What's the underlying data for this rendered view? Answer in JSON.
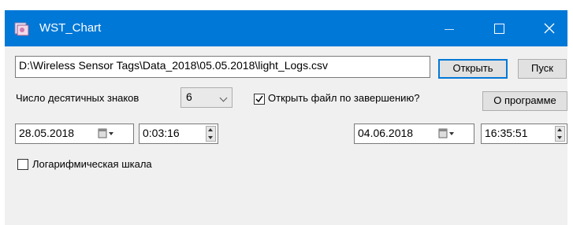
{
  "window": {
    "title": "WST_Chart",
    "accent": "#0078d7"
  },
  "file": {
    "path": "D:\\Wireless Sensor Tags\\Data_2018\\05.05.2018\\light_Logs.csv"
  },
  "buttons": {
    "open": "Открыть",
    "start": "Пуск",
    "about": "О программе"
  },
  "decimals": {
    "label": "Число десятичных знаков",
    "value": "6"
  },
  "open_on_finish": {
    "label": "Открыть файл по завершению?",
    "checked": true
  },
  "start_date": {
    "date": "28.05.2018",
    "time": "0:03:16"
  },
  "end_date": {
    "date": "04.06.2018",
    "time": "16:35:51"
  },
  "log_scale": {
    "label": "Логарифмическая шкала",
    "checked": false
  }
}
